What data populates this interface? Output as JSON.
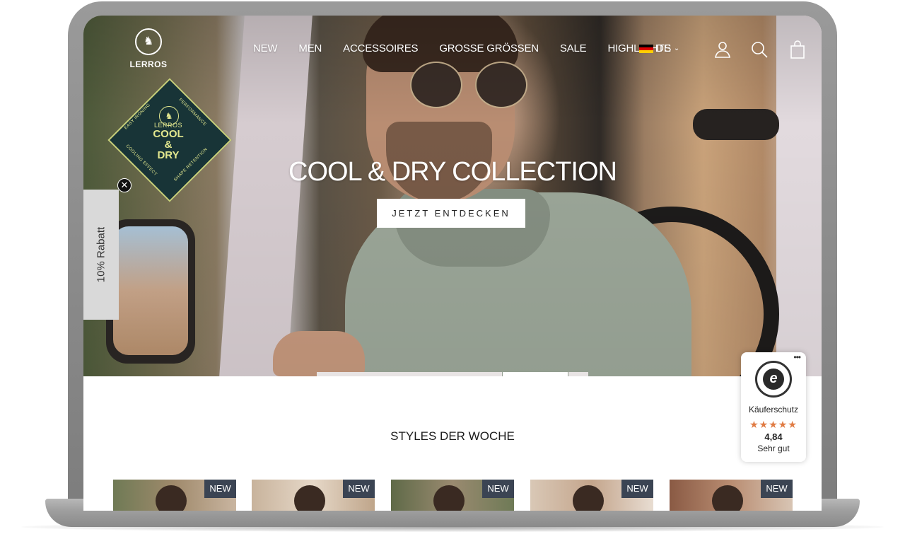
{
  "brand": {
    "name": "LERROS"
  },
  "nav": {
    "items": [
      {
        "label": "NEW"
      },
      {
        "label": "MEN"
      },
      {
        "label": "ACCESSOIRES"
      },
      {
        "label": "GROSSE GRÖSSEN"
      },
      {
        "label": "SALE"
      },
      {
        "label": "HIGHLIGHTS"
      }
    ],
    "language": "DE",
    "icons": [
      "account-icon",
      "search-icon",
      "cart-icon"
    ]
  },
  "badge": {
    "brand": "LERROS",
    "title_line1": "COOL",
    "title_line2": "&",
    "title_line3": "DRY",
    "arc_top_left": "EASY IRONING",
    "arc_top_right": "PERFORMANCE",
    "arc_bottom_left": "COOLING EFFECT",
    "arc_bottom_right": "SHAPE RETENTION"
  },
  "popup": {
    "close_symbol": "✕",
    "rabatt_label": "10% Rabatt"
  },
  "hero": {
    "title": "COOL & DRY COLLECTION",
    "cta_label": "JETZT ENTDECKEN",
    "slides": 3,
    "active_slide": 2
  },
  "section": {
    "title": "STYLES DER WOCHE",
    "products": [
      {
        "tag": "NEW"
      },
      {
        "tag": "NEW"
      },
      {
        "tag": "NEW"
      },
      {
        "tag": "NEW"
      },
      {
        "tag": "NEW"
      }
    ]
  },
  "trusted_shops": {
    "label": "Käuferschutz",
    "stars": "★★★★★",
    "score": "4,84",
    "rating_text": "Sehr gut",
    "menu_dots": "•••",
    "seal_letter": "e",
    "star_color": "#e07b43"
  }
}
